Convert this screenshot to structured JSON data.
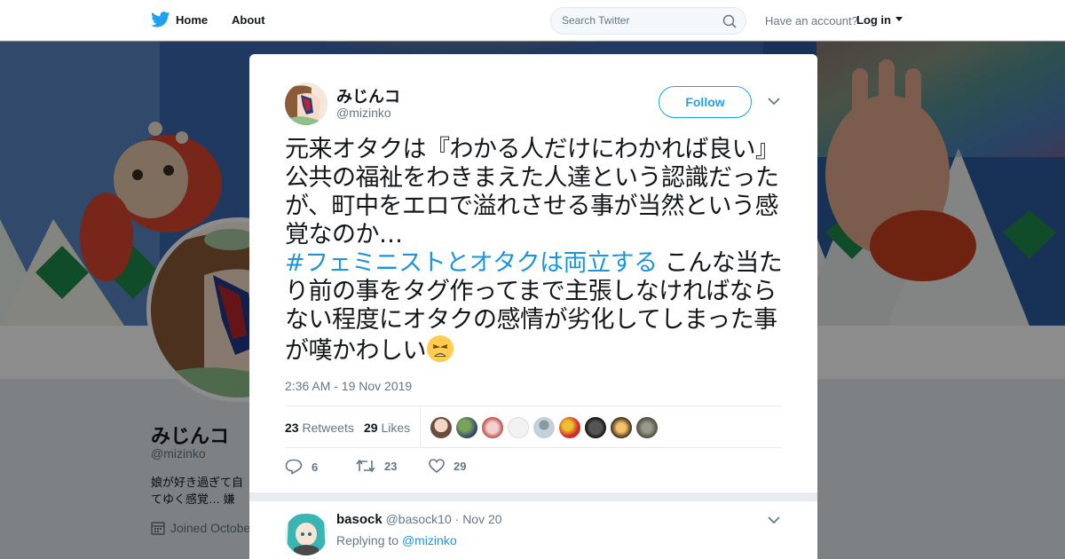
{
  "nav": {
    "home_label": "Home",
    "about_label": "About",
    "search_placeholder": "Search Twitter",
    "have_account": "Have an account?",
    "login_label": "Log in"
  },
  "profile": {
    "name": "みじんコ",
    "handle": "@mizinko",
    "bio": "娘が好き過ぎて自てゆく感覚… 嫌",
    "joined": "Joined Octobe"
  },
  "tweet": {
    "author_name": "みじんコ",
    "author_handle": "@mizinko",
    "follow_label": "Follow",
    "text_part1": "元来オタクは『わかる人だけにわかれば良い』公共の福祉をわきまえた人達という認識だったが、町中をエロで溢れさせる事が当然という感覚なのか…",
    "hashtag": "#フェミニストとオタクは両立する",
    "text_part2": " こんな当たり前の事をタグ作ってまで主張しなければならない程度にオタクの感情が劣化してしまった事が嘆かわしい",
    "timestamp": "2:36 AM - 19 Nov 2019",
    "retweets_count": "23",
    "retweets_label": "Retweets",
    "likes_count": "29",
    "likes_label": "Likes",
    "reply_count": "6",
    "retweet_action_count": "23",
    "like_action_count": "29"
  },
  "reply": {
    "name": "basock",
    "handle": "@basock10",
    "date": "· Nov 20",
    "replying_prefix": "Replying to ",
    "replying_to": "@mizinko"
  },
  "colors": {
    "accent": "#1da1f2",
    "link": "#1b95e0",
    "muted": "#657786"
  }
}
